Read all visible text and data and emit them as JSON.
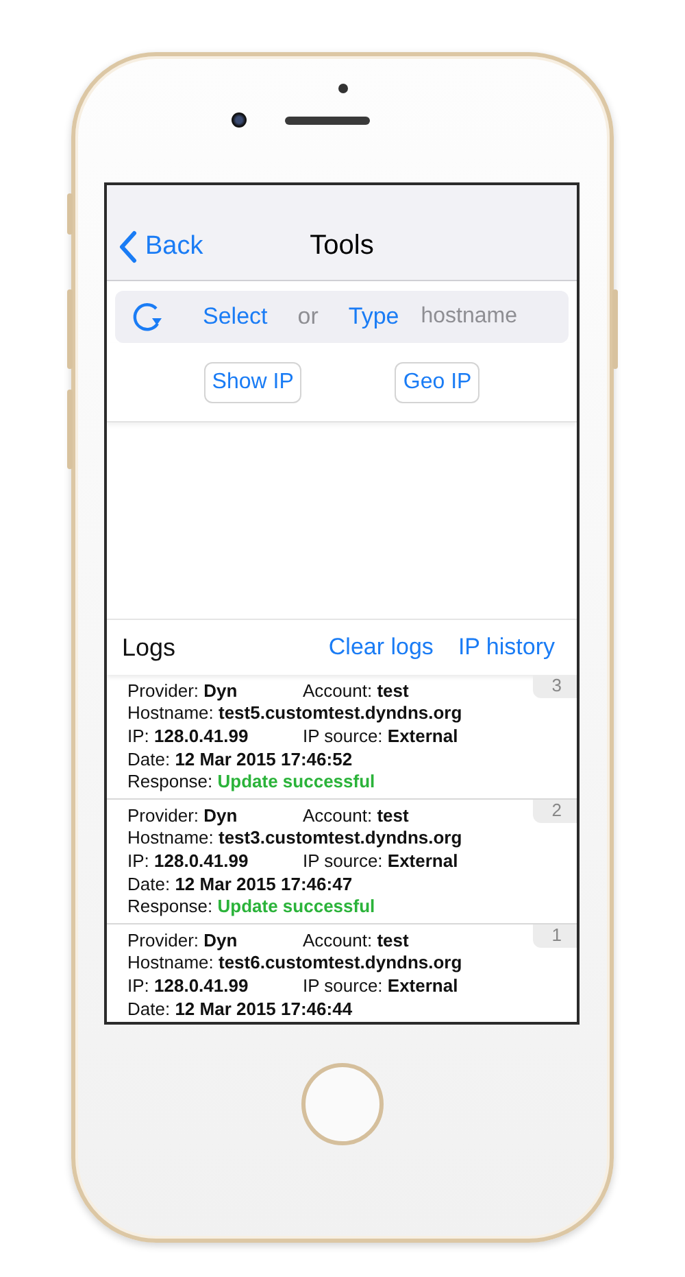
{
  "nav": {
    "back": "Back",
    "title": "Tools"
  },
  "search": {
    "select": "Select",
    "or": "or",
    "type": "Type",
    "placeholder": "hostname"
  },
  "buttons": [
    "Show IP",
    "Geo IP"
  ],
  "logs": {
    "title": "Logs",
    "actions": [
      "Clear logs",
      "IP history"
    ],
    "entries": [
      {
        "number": "3",
        "rows": [
          [
            {
              "label": "Provider:",
              "value": "Dyn"
            },
            {
              "label": "Account:",
              "value": "test"
            }
          ],
          [
            {
              "label": "Hostname:",
              "value": "test5.customtest.dyndns.org"
            }
          ],
          [
            {
              "label": "IP:",
              "value": "128.0.41.99"
            },
            {
              "label": "IP source:",
              "value": "External"
            }
          ],
          [
            {
              "label": "Date:",
              "value": "12 Mar 2015 17:46:52"
            }
          ]
        ],
        "response": {
          "label": "Response:",
          "value": "Update successful"
        }
      },
      {
        "number": "2",
        "rows": [
          [
            {
              "label": "Provider:",
              "value": "Dyn"
            },
            {
              "label": "Account:",
              "value": "test"
            }
          ],
          [
            {
              "label": "Hostname:",
              "value": "test3.customtest.dyndns.org"
            }
          ],
          [
            {
              "label": "IP:",
              "value": "128.0.41.99"
            },
            {
              "label": "IP source:",
              "value": "External"
            }
          ],
          [
            {
              "label": "Date:",
              "value": "12 Mar 2015 17:46:47"
            }
          ]
        ],
        "response": {
          "label": "Response:",
          "value": "Update successful"
        }
      },
      {
        "number": "1",
        "rows": [
          [
            {
              "label": "Provider:",
              "value": "Dyn"
            },
            {
              "label": "Account:",
              "value": "test"
            }
          ],
          [
            {
              "label": "Hostname:",
              "value": "test6.customtest.dyndns.org"
            }
          ],
          [
            {
              "label": "IP:",
              "value": "128.0.41.99"
            },
            {
              "label": "IP source:",
              "value": "External"
            }
          ],
          [
            {
              "label": "Date:",
              "value": "12 Mar 2015 17:46:44"
            }
          ]
        ]
      }
    ]
  }
}
